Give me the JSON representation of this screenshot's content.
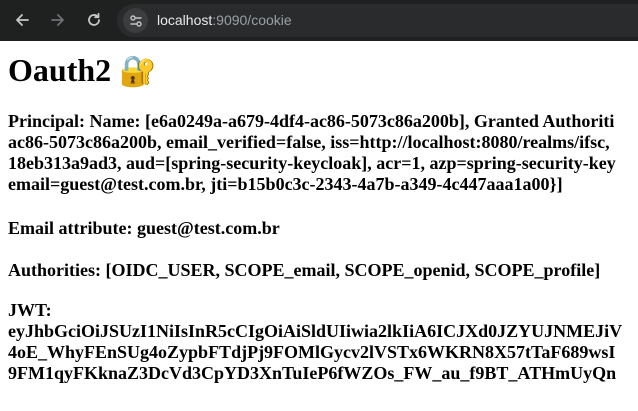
{
  "browser": {
    "url_host": "localhost",
    "url_path": ":9090/cookie"
  },
  "page": {
    "title": "Oauth2",
    "title_emoji": "🔐",
    "principal_lines": [
      "Principal: Name: [e6a0249a-a679-4df4-ac86-5073c86a200b], Granted Authoriti",
      "ac86-5073c86a200b, email_verified=false, iss=http://localhost:8080/realms/ifsc,",
      "18eb313a9ad3, aud=[spring-security-keycloak], acr=1, azp=spring-security-key",
      "email=guest@test.com.br, jti=b15b0c3c-2343-4a7b-a349-4c447aaa1a00}]"
    ],
    "email_attribute": "Email attribute: guest@test.com.br",
    "authorities": "Authorities: [OIDC_USER, SCOPE_email, SCOPE_openid, SCOPE_profile]",
    "jwt_label": "JWT:",
    "jwt_lines": [
      "eyJhbGciOiJSUzI1NiIsInR5cCIgOiAiSldUIiwia2lkIiA6ICJXd0JZYUJNMEJiV",
      "4oE_WhyFEnSUg4oZypbFTdjPj9FOMlGycv2lVSTx6WKRN8X57tTaF689wsI",
      "9FM1qyFKknaZ3DcVd3CpYD3XnTuIeP6fWZOs_FW_au_f9BT_ATHmUyQn"
    ]
  },
  "colors": {
    "toolbar_bg": "#1f2020",
    "omnibox_bg": "#2a2b2c",
    "icon": "#c4c7c5",
    "icon_disabled": "#6f7275"
  },
  "icons": [
    "back-arrow-icon",
    "forward-arrow-icon",
    "reload-icon",
    "site-info-icon"
  ]
}
